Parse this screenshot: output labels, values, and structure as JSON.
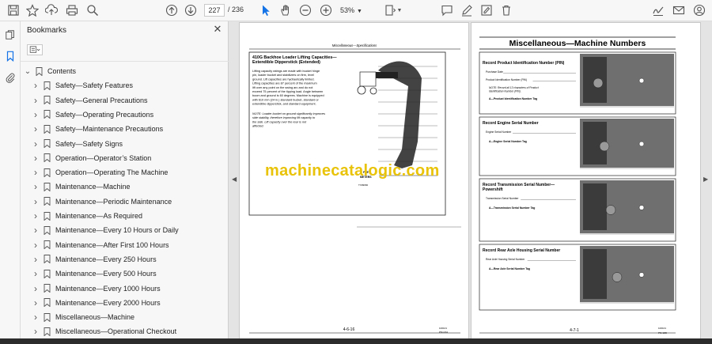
{
  "toolbar": {
    "page_current": "227",
    "page_total": "/ 236",
    "zoom": "53%",
    "icons": [
      "save-icon",
      "star-icon",
      "upload-icon",
      "print-icon",
      "search-icon",
      "page-up-icon",
      "page-down-icon",
      "select-cursor-icon",
      "hand-icon",
      "zoom-out-icon",
      "zoom-in-icon",
      "fit-page-icon",
      "comment-icon",
      "draw-icon",
      "fill-sign-icon",
      "delete-icon",
      "sign-icon",
      "mail-icon",
      "account-icon"
    ]
  },
  "panel": {
    "title": "Bookmarks",
    "bookmarks": [
      {
        "label": "Contents",
        "level": 0,
        "chevron": "down"
      },
      {
        "label": "Safety—Safety Features",
        "level": 1,
        "chevron": "right"
      },
      {
        "label": "Safety—General Precautions",
        "level": 1,
        "chevron": "right"
      },
      {
        "label": "Safety—Operating Precautions",
        "level": 1,
        "chevron": "right"
      },
      {
        "label": "Safety—Maintenance Precautions",
        "level": 1,
        "chevron": "right"
      },
      {
        "label": "Safety—Safety Signs",
        "level": 1,
        "chevron": "right"
      },
      {
        "label": "Operation—Operator’s Station",
        "level": 1,
        "chevron": "right"
      },
      {
        "label": "Operation—Operating The Machine",
        "level": 1,
        "chevron": "right"
      },
      {
        "label": "Maintenance—Machine",
        "level": 1,
        "chevron": "right"
      },
      {
        "label": "Maintenance—Periodic Maintenance",
        "level": 1,
        "chevron": "right"
      },
      {
        "label": "Maintenance—As Required",
        "level": 1,
        "chevron": "right"
      },
      {
        "label": "Maintenance—Every 10 Hours or Daily",
        "level": 1,
        "chevron": "right"
      },
      {
        "label": "Maintenance—After First 100 Hours",
        "level": 1,
        "chevron": "right"
      },
      {
        "label": "Maintenance—Every 250 Hours",
        "level": 1,
        "chevron": "right"
      },
      {
        "label": "Maintenance—Every 500 Hours",
        "level": 1,
        "chevron": "right"
      },
      {
        "label": "Maintenance—Every 1000 Hours",
        "level": 1,
        "chevron": "right"
      },
      {
        "label": "Maintenance—Every 2000 Hours",
        "level": 1,
        "chevron": "right"
      },
      {
        "label": "Miscellaneous—Machine",
        "level": 1,
        "chevron": "right"
      },
      {
        "label": "Miscellaneous—Operational Checkout",
        "level": 1,
        "chevron": "right"
      }
    ]
  },
  "left_page": {
    "header": "Miscellaneous—Specifications",
    "box_title": "410G Backhoe Loader Lifting Capacities—Extendible Dipperstick (Extended)",
    "body": "Lifting capacity ratings are made with bucket hinge pin, loader bucket and stabilizers on firm, level ground. Lift capacities are hydraulically limited. Lifting capacities are 87 percent of the maximum lift over any point on the swing arc and do not exceed 75 percent of the tipping load. Angle between boom and ground is 60 degrees. Machine is equipped with 610 mm (24 in.) standard bucket, standard or extendible dipperstick, and standard equipment.",
    "note": "NOTE: Loader bucket on ground significantly improves side stability, therefore improving lift capacity to the side. Lift capacity over the rear is not affected.",
    "axis_feet": "FEET",
    "axis_meters": "METERS",
    "axis_tx": "TX09960",
    "footer_page": "4-6-16",
    "footer_code": "PN=224",
    "footer_ref": "100101"
  },
  "right_page": {
    "title": "Miscellaneous—Machine Numbers",
    "sections": [
      {
        "heading": "Record Product Identification Number (PIN)",
        "fields": [
          "Purchase Date",
          "Product Identification Number (PIN)"
        ],
        "note": "NOTE: Record all 13 characters of Product Identification Number (PIN).",
        "tag": "A—Product Identification Number Tag"
      },
      {
        "heading": "Record Engine Serial Number",
        "fields": [
          "Engine Serial Number"
        ],
        "note": "",
        "tag": "A—Engine Serial Number Tag"
      },
      {
        "heading": "Record Transmission Serial Number—Powershift",
        "fields": [
          "Transmission Serial Number"
        ],
        "note": "",
        "tag": "A—Transmission Serial Number Tag"
      },
      {
        "heading": "Record Rear Axle Housing Serial Number",
        "fields": [
          "Rear Axle Housing Serial Number"
        ],
        "note": "",
        "tag": "A—Rear Axle Serial Number Tag"
      }
    ],
    "footer_page": "4-7-1",
    "footer_code": "PN=225",
    "footer_ref": "100101"
  },
  "watermark": "machinecatalogic.com",
  "colors": {
    "watermark": "#e8c30a",
    "selected_tool": "#1473e6"
  }
}
